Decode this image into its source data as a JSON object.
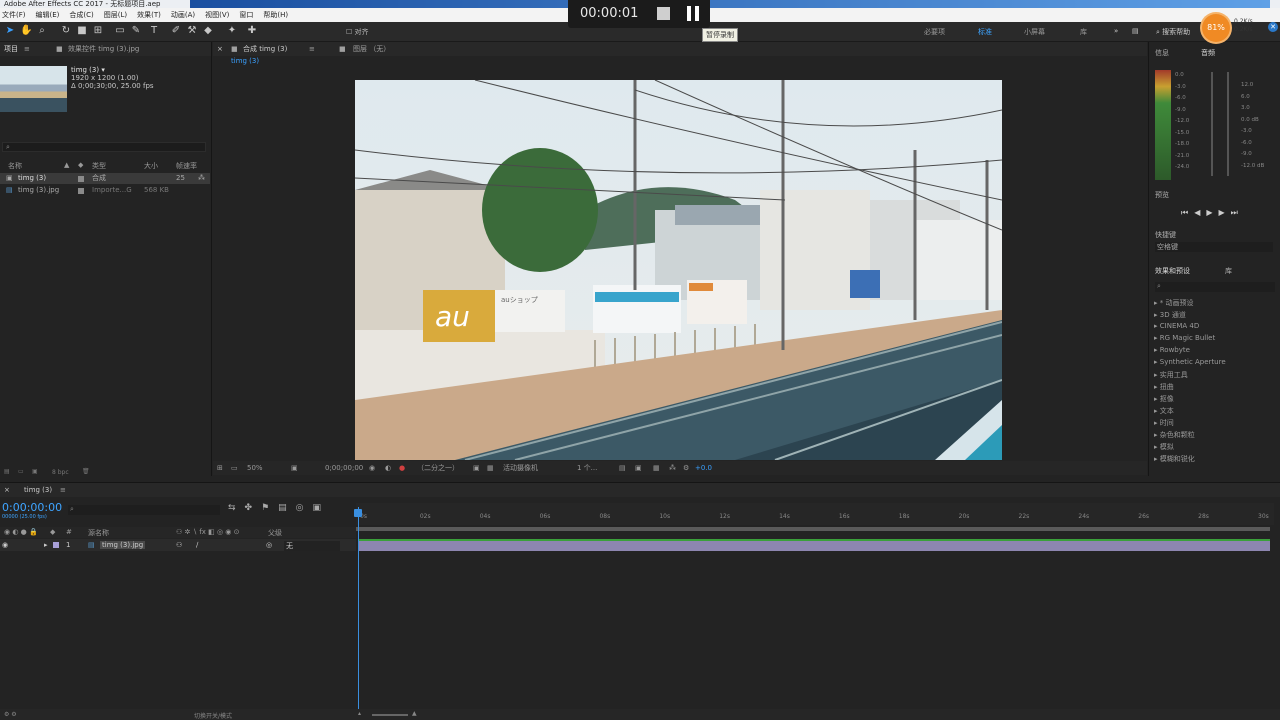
{
  "window": {
    "title": "Adobe After Effects CC 2017 - 无标题项目.aep"
  },
  "menu": [
    "文件(F)",
    "编辑(E)",
    "合成(C)",
    "图层(L)",
    "效果(T)",
    "动画(A)",
    "视图(V)",
    "窗口",
    "帮助(H)"
  ],
  "toolbar": {
    "snap_label": "对齐",
    "workspaces": [
      "必要项",
      "标准",
      "小屏幕",
      "库"
    ],
    "active_workspace": "标准",
    "search_placeholder": "搜索帮助"
  },
  "recorder": {
    "time": "00:00:01",
    "tooltip": "暂停录制"
  },
  "system": {
    "cpu": "81%",
    "net_up": "0.2K/s",
    "net_down": "0.2K/s"
  },
  "project": {
    "tab": "项目",
    "effects_tab": "效果控件 timg (3).jpg",
    "selected_name": "timg (3) ▾",
    "selected_dims": "1920 x 1200 (1.00)",
    "selected_duration": "Δ 0;00;30;00, 25.00 fps",
    "columns": [
      "名称",
      "类型",
      "大小",
      "帧速率"
    ],
    "rows": [
      {
        "name": "timg (3)",
        "type": "合成",
        "size": "",
        "fps": "25",
        "color": "#8a8a8a"
      },
      {
        "name": "timg (3).jpg",
        "type": "Importe...G",
        "size": "568 KB",
        "fps": "",
        "color": "#8a8a8a"
      }
    ],
    "bpc": "8 bpc"
  },
  "comp": {
    "tab": "合成 timg (3)",
    "layer_tab": "图层 （无）",
    "breadcrumb": "timg (3)",
    "zoom": "50%",
    "time": "0;00;00;00",
    "resolution": "（二分之一）",
    "camera": "活动摄像机",
    "views": "1 个...",
    "exposure": "+0.0"
  },
  "right": {
    "info_tab": "信息",
    "audio_tab": "音频",
    "db_left": [
      "0.0",
      "-3.0",
      "-6.0",
      "-9.0",
      "-12.0",
      "-15.0",
      "-18.0",
      "-21.0",
      "-24.0"
    ],
    "db_right": [
      "12.0",
      "6.0",
      "3.0",
      "0.0 dB",
      "-3.0",
      "-6.0",
      "-9.0",
      "-12.0 dB"
    ],
    "preview_tab": "预览",
    "shortcut_label": "快捷键",
    "shortcut_value": "空格键",
    "fx_tab": "效果和预设",
    "library_tab": "库",
    "effects": [
      "* 动画预设",
      "3D 通道",
      "CINEMA 4D",
      "RG Magic Bullet",
      "Rowbyte",
      "Synthetic Aperture",
      "实用工具",
      "扭曲",
      "抠像",
      "文本",
      "时间",
      "杂色和颗粒",
      "模拟",
      "模糊和锐化"
    ]
  },
  "timeline": {
    "tab": "timg (3)",
    "time": "0:00:00:00",
    "fps_sub": "00000 (25.00 fps)",
    "columns": [
      "源名称",
      "父级"
    ],
    "layer": {
      "index": "1",
      "name": "timg (3).jpg",
      "parent": "无"
    },
    "ticks": [
      "0s",
      "02s",
      "04s",
      "06s",
      "08s",
      "10s",
      "12s",
      "14s",
      "16s",
      "18s",
      "20s",
      "22s",
      "24s",
      "26s",
      "28s",
      "30s"
    ],
    "footer": "切换开关/模式"
  },
  "photo_signs": {
    "au": "au",
    "shop": "auショップ"
  }
}
